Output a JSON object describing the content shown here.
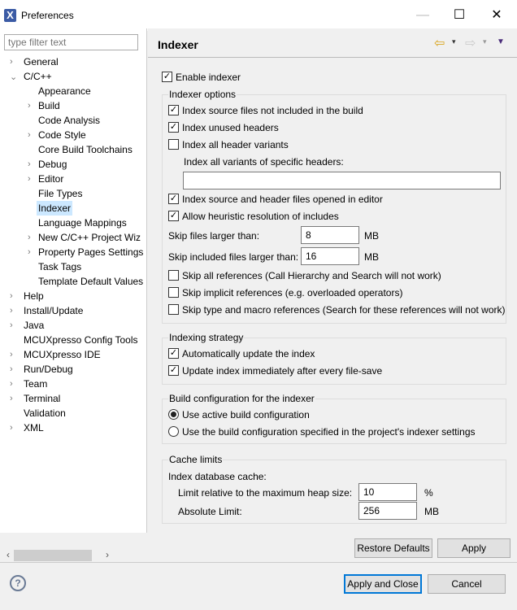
{
  "window": {
    "title": "Preferences",
    "minimize": "—",
    "maximize": "☐",
    "close": "✕",
    "app_icon": "X"
  },
  "sidebar": {
    "filter_placeholder": "type filter text",
    "items": [
      {
        "label": "General",
        "level": 0,
        "chevron": ">"
      },
      {
        "label": "C/C++",
        "level": 0,
        "chevron": "v"
      },
      {
        "label": "Appearance",
        "level": 1,
        "chevron": ""
      },
      {
        "label": "Build",
        "level": 1,
        "chevron": ">"
      },
      {
        "label": "Code Analysis",
        "level": 1,
        "chevron": ""
      },
      {
        "label": "Code Style",
        "level": 1,
        "chevron": ">"
      },
      {
        "label": "Core Build Toolchains",
        "level": 1,
        "chevron": ""
      },
      {
        "label": "Debug",
        "level": 1,
        "chevron": ">"
      },
      {
        "label": "Editor",
        "level": 1,
        "chevron": ">"
      },
      {
        "label": "File Types",
        "level": 1,
        "chevron": ""
      },
      {
        "label": "Indexer",
        "level": 1,
        "chevron": "",
        "selected": true
      },
      {
        "label": "Language Mappings",
        "level": 1,
        "chevron": ""
      },
      {
        "label": "New C/C++ Project Wiz",
        "level": 1,
        "chevron": ">"
      },
      {
        "label": "Property Pages Settings",
        "level": 1,
        "chevron": ">"
      },
      {
        "label": "Task Tags",
        "level": 1,
        "chevron": ""
      },
      {
        "label": "Template Default Values",
        "level": 1,
        "chevron": ""
      },
      {
        "label": "Help",
        "level": 0,
        "chevron": ">"
      },
      {
        "label": "Install/Update",
        "level": 0,
        "chevron": ">"
      },
      {
        "label": "Java",
        "level": 0,
        "chevron": ">"
      },
      {
        "label": "MCUXpresso Config Tools",
        "level": 0,
        "chevron": ""
      },
      {
        "label": "MCUXpresso IDE",
        "level": 0,
        "chevron": ">"
      },
      {
        "label": "Run/Debug",
        "level": 0,
        "chevron": ">"
      },
      {
        "label": "Team",
        "level": 0,
        "chevron": ">"
      },
      {
        "label": "Terminal",
        "level": 0,
        "chevron": ">"
      },
      {
        "label": "Validation",
        "level": 0,
        "chevron": ""
      },
      {
        "label": "XML",
        "level": 0,
        "chevron": ">"
      }
    ]
  },
  "page": {
    "title": "Indexer",
    "back": "⇦",
    "forward": "⇨",
    "menu": "▼",
    "dd": "▾",
    "enable_indexer": "Enable indexer",
    "options": {
      "title": "Indexer options",
      "not_in_build": "Index source files not included in the build",
      "unused_headers": "Index unused headers",
      "all_variants": "Index all header variants",
      "specific_headers_label": "Index all variants of specific headers:",
      "specific_headers_value": "",
      "opened_in_editor": "Index source and header files opened in editor",
      "heuristic": "Allow heuristic resolution of includes",
      "skip_larger_label": "Skip files larger than:",
      "skip_larger_value": "8",
      "mb1": "MB",
      "skip_included_label": "Skip included files larger than:",
      "skip_included_value": "16",
      "mb2": "MB",
      "skip_all_refs": "Skip all references (Call Hierarchy and Search will not work)",
      "skip_implicit": "Skip implicit references (e.g. overloaded operators)",
      "skip_type_macro": "Skip type and macro references (Search for these references will not work)"
    },
    "strategy": {
      "title": "Indexing strategy",
      "auto_update": "Automatically update the index",
      "update_on_save": "Update index immediately after every file-save"
    },
    "build_config": {
      "title": "Build configuration for the indexer",
      "active": "Use active build configuration",
      "specified": "Use the build configuration specified in the project's indexer settings"
    },
    "cache": {
      "title": "Cache limits",
      "db_cache": "Index database cache:",
      "relative_label": "Limit relative to the maximum heap size:",
      "relative_value": "10",
      "percent": "%",
      "absolute_label": "Absolute Limit:",
      "absolute_value": "256",
      "mb": "MB"
    },
    "restore_defaults": "Restore Defaults",
    "apply": "Apply"
  },
  "footer": {
    "help": "?",
    "apply_close": "Apply and Close",
    "cancel": "Cancel"
  }
}
